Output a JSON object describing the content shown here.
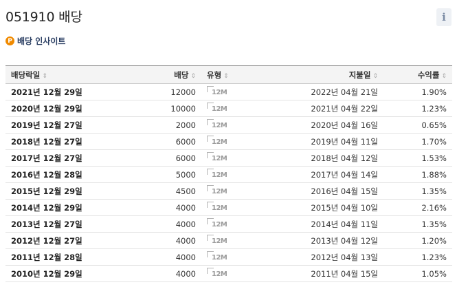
{
  "page_title": "051910 배당",
  "info_label": "i",
  "insight": {
    "icon_letter": "P",
    "label": "배당 인사이트"
  },
  "table": {
    "headers": {
      "ex_date": "배당락일",
      "amount": "배당",
      "type": "유형",
      "pay_date": "지불일",
      "yield": "수익률"
    },
    "sort_glyph": "⇕",
    "type_icon_text": "12M",
    "rows": [
      {
        "ex_date": "2021년 12월 29일",
        "amount": "12000",
        "type": "12M",
        "pay_date": "2022년 04월 21일",
        "yield": "1.90%"
      },
      {
        "ex_date": "2020년 12월 29일",
        "amount": "10000",
        "type": "12M",
        "pay_date": "2021년 04월 22일",
        "yield": "1.23%"
      },
      {
        "ex_date": "2019년 12월 27일",
        "amount": "2000",
        "type": "12M",
        "pay_date": "2020년 04월 16일",
        "yield": "0.65%"
      },
      {
        "ex_date": "2018년 12월 27일",
        "amount": "6000",
        "type": "12M",
        "pay_date": "2019년 04월 11일",
        "yield": "1.70%"
      },
      {
        "ex_date": "2017년 12월 27일",
        "amount": "6000",
        "type": "12M",
        "pay_date": "2018년 04월 12일",
        "yield": "1.53%"
      },
      {
        "ex_date": "2016년 12월 28일",
        "amount": "5000",
        "type": "12M",
        "pay_date": "2017년 04월 14일",
        "yield": "1.88%"
      },
      {
        "ex_date": "2015년 12월 29일",
        "amount": "4500",
        "type": "12M",
        "pay_date": "2016년 04월 15일",
        "yield": "1.35%"
      },
      {
        "ex_date": "2014년 12월 29일",
        "amount": "4000",
        "type": "12M",
        "pay_date": "2015년 04월 10일",
        "yield": "2.16%"
      },
      {
        "ex_date": "2013년 12월 27일",
        "amount": "4000",
        "type": "12M",
        "pay_date": "2014년 04월 11일",
        "yield": "1.35%"
      },
      {
        "ex_date": "2012년 12월 27일",
        "amount": "4000",
        "type": "12M",
        "pay_date": "2013년 04월 12일",
        "yield": "1.20%"
      },
      {
        "ex_date": "2011년 12월 28일",
        "amount": "4000",
        "type": "12M",
        "pay_date": "2012년 04월 13일",
        "yield": "1.23%"
      },
      {
        "ex_date": "2010년 12월 29일",
        "amount": "4000",
        "type": "12M",
        "pay_date": "2011년 04월 15일",
        "yield": "1.05%"
      }
    ]
  }
}
